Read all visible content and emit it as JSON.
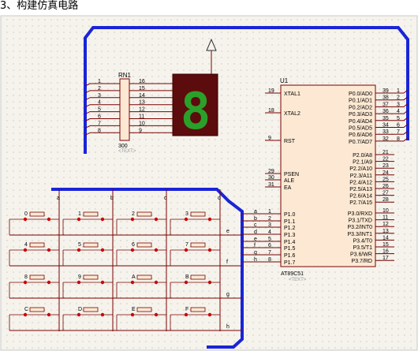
{
  "heading": "3、构建仿真电路",
  "colors": {
    "grid_bg": "#f5f3ec",
    "grid_dot": "#9b9b9b",
    "bus": "#1a24d8",
    "wire": "#7a0000",
    "chip_fill": "#fde9d3",
    "chip_stroke": "#7a0000",
    "seg_bg": "#5c0c0c",
    "seg_on": "#2aa02a",
    "key_dot": "#cc0000"
  },
  "rn1": {
    "name": "RN1",
    "value": "300",
    "text_tag": "<TEXT>",
    "left_pins": [
      "1",
      "2",
      "3",
      "4",
      "5",
      "6",
      "7",
      "8"
    ],
    "right_pins": [
      "16",
      "15",
      "14",
      "13",
      "12",
      "11",
      "10",
      "9"
    ]
  },
  "display": {
    "digit": "8"
  },
  "u1": {
    "name": "U1",
    "part": "AT89C51",
    "text_tag": "<TEXT>",
    "left_labels": [
      "XTAL1",
      "XTAL2",
      "RST",
      "PSEN",
      "ALE",
      "EA",
      "P1.0",
      "P1.1",
      "P1.2",
      "P1.3",
      "P1.4",
      "P1.5",
      "P1.6",
      "P1.7"
    ],
    "left_nums": [
      "19",
      "18",
      "9",
      "29",
      "30",
      "31",
      "1",
      "2",
      "3",
      "4",
      "5",
      "6",
      "7",
      "8"
    ],
    "right_labels": [
      "P0.0/AD0",
      "P0.1/AD1",
      "P0.2/AD2",
      "P0.3/AD3",
      "P0.4/AD4",
      "P0.5/AD5",
      "P0.6/AD6",
      "P0.7/AD7",
      "P2.0/A8",
      "P2.1/A9",
      "P2.2/A10",
      "P2.3/A11",
      "P2.4/A12",
      "P2.5/A13",
      "P2.6/A14",
      "P2.7/A15",
      "P3.0/RXD",
      "P3.1/TXD",
      "P3.2/INT0",
      "P3.3/INT1",
      "P3.4/T0",
      "P3.5/T1",
      "P3.6/WR",
      "P3.7/RD"
    ],
    "right_nums": [
      "39",
      "38",
      "37",
      "36",
      "35",
      "34",
      "33",
      "32",
      "21",
      "22",
      "23",
      "24",
      "25",
      "26",
      "27",
      "28",
      "10",
      "11",
      "12",
      "13",
      "14",
      "15",
      "16",
      "17"
    ],
    "p0_outer_nums": [
      "1",
      "2",
      "3",
      "4",
      "5",
      "6",
      "7",
      "8"
    ]
  },
  "bus_labels": {
    "p1": [
      "a",
      "b",
      "c",
      "d",
      "e",
      "f",
      "g",
      "h"
    ],
    "columns": [
      "a",
      "b",
      "c",
      "d"
    ],
    "rows": [
      "e",
      "f",
      "g",
      "h"
    ]
  },
  "keys": [
    "0",
    "1",
    "2",
    "3",
    "4",
    "5",
    "6",
    "7",
    "8",
    "9",
    "A",
    "B",
    "C",
    "D",
    "E",
    "F"
  ]
}
